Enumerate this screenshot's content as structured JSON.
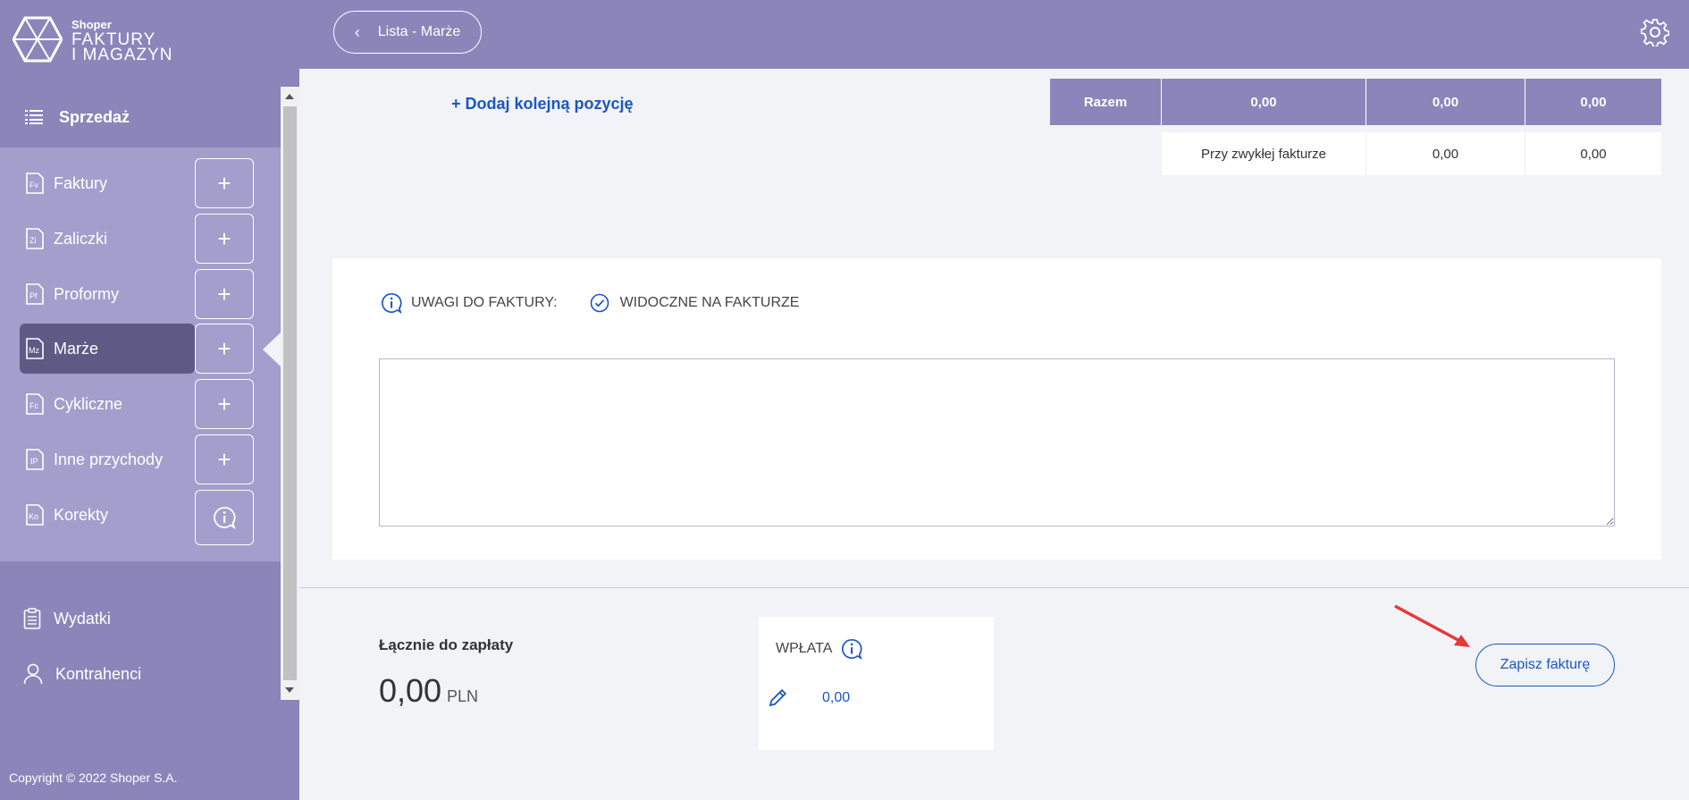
{
  "app": {
    "brand_small": "Shoper",
    "brand_line1": "FAKTURY",
    "brand_line2": "I MAGAZYN"
  },
  "sidebar": {
    "section_label": "Sprzedaż",
    "items": [
      {
        "label": "Faktury",
        "icon": "document-fv-icon",
        "action": "+"
      },
      {
        "label": "Zaliczki",
        "icon": "document-zl-icon",
        "action": "+"
      },
      {
        "label": "Proformy",
        "icon": "document-pf-icon",
        "action": "+"
      },
      {
        "label": "Marże",
        "icon": "document-mz-icon",
        "action": "+",
        "active": true
      },
      {
        "label": "Cykliczne",
        "icon": "document-fc-icon",
        "action": "+"
      },
      {
        "label": "Inne przychody",
        "icon": "document-ip-icon",
        "action": "+"
      },
      {
        "label": "Korekty",
        "icon": "document-ko-icon",
        "action": "info"
      }
    ],
    "lower_items": [
      {
        "label": "Wydatki",
        "icon": "clipboard-icon"
      },
      {
        "label": "Kontrahenci",
        "icon": "user-icon"
      }
    ],
    "copyright": "Copyright © 2022 Shoper S.A."
  },
  "topbar": {
    "back_label": "Lista - Marże"
  },
  "totals": {
    "add_position": "+ Dodaj kolejną pozycję",
    "header_label": "Razem",
    "header_values": [
      "0,00",
      "0,00",
      "0,00"
    ],
    "sub_label": "Przy zwykłej fakturze",
    "sub_values": [
      "0,00",
      "0,00"
    ]
  },
  "remarks": {
    "label": "UWAGI DO FAKTURY:",
    "visible_label": "WIDOCZNE NA FAKTURZE",
    "value": ""
  },
  "summary": {
    "total_label": "Łącznie do zapłaty",
    "total_value": "0,00",
    "currency": "PLN"
  },
  "payment": {
    "title": "WPŁATA",
    "value": "0,00"
  },
  "actions": {
    "save_label": "Zapisz fakturę"
  },
  "colors": {
    "primary": "#8c85ba",
    "accent": "#1a56c4",
    "annotation": "#e53935"
  }
}
